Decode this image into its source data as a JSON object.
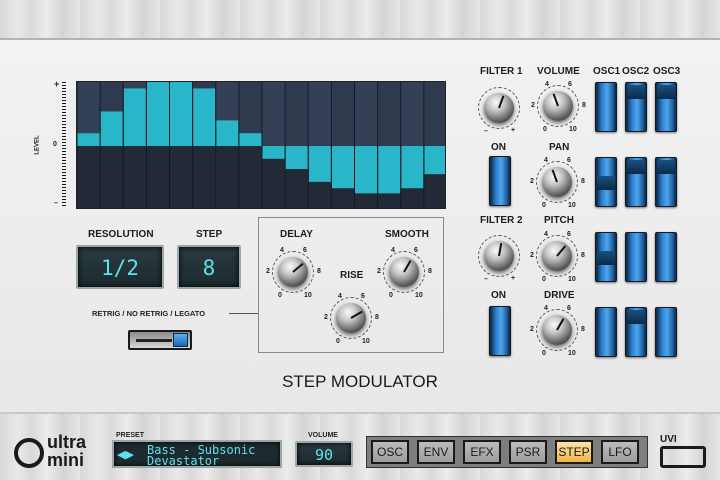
{
  "title": "STEP MODULATOR",
  "graph": {
    "axis_plus": "+",
    "axis_zero": "0",
    "axis_minus": "–",
    "axis_label": "LEVEL",
    "steps": [
      0.1,
      0.27,
      0.45,
      0.5,
      0.5,
      0.45,
      0.2,
      0.1,
      -0.1,
      -0.18,
      -0.28,
      -0.33,
      -0.37,
      -0.37,
      -0.33,
      -0.22
    ]
  },
  "resolution": {
    "label": "RESOLUTION",
    "value": "1/2"
  },
  "step": {
    "label": "STEP",
    "value": "8"
  },
  "retrig": {
    "label": "RETRIG / NO RETRIG / LEGATO",
    "position": 1
  },
  "delay": {
    "label": "DELAY"
  },
  "rise": {
    "label": "RISE"
  },
  "smooth": {
    "label": "SMOOTH"
  },
  "scale": {
    "s0": "0",
    "s2": "2",
    "s4": "4",
    "s6": "6",
    "s8": "8",
    "s10": "10",
    "minus": "–",
    "plus": "+"
  },
  "right": {
    "filter1": "FILTER 1",
    "filter2": "FILTER 2",
    "on1": "ON",
    "on2": "ON",
    "volume": "VOLUME",
    "pan": "PAN",
    "pitch": "PITCH",
    "drive": "DRIVE",
    "osc1": "OSC1",
    "osc2": "OSC2",
    "osc3": "OSC3"
  },
  "footer": {
    "logo_top": "ultra",
    "logo_bottom": "mini",
    "preset_label": "PRESET",
    "preset_line1": "Bass - Subsonic",
    "preset_line2": "Devastator",
    "volume_label": "VOLUME",
    "volume_value": "90",
    "tabs": [
      "OSC",
      "ENV",
      "EFX",
      "PSR",
      "STEP",
      "LFO"
    ],
    "active_tab": "STEP",
    "uvi": "UVI"
  },
  "colors": {
    "accent": "#3fc8dc",
    "step_bar": "#29b6c8",
    "graph_bg": "#2c3446",
    "switch_blue": "#3a8fdc",
    "active_tab": "#f5c060"
  }
}
